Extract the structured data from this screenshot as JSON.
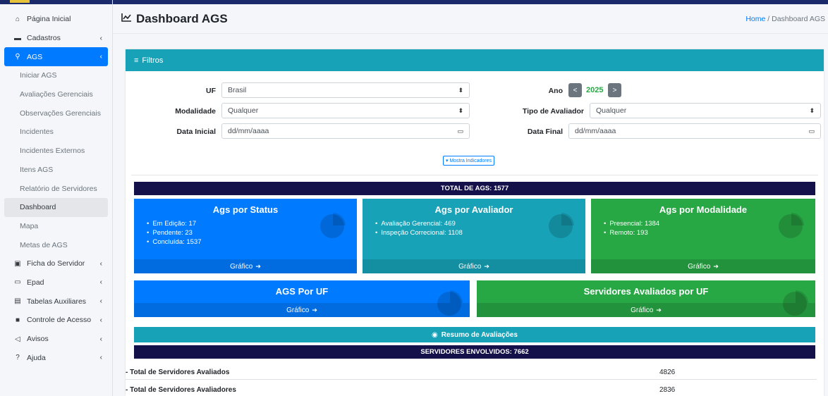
{
  "sidebar": {
    "items": [
      {
        "label": "Página Inicial",
        "icon": "home-icon",
        "glyph": "⌂"
      },
      {
        "label": "Cadastros",
        "icon": "folder-icon",
        "glyph": "▬",
        "chevron": "‹"
      },
      {
        "label": "AGS",
        "icon": "search-icon",
        "glyph": "⚲",
        "chevron": "‹"
      },
      {
        "label": "Iniciar AGS"
      },
      {
        "label": "Avaliações Gerenciais"
      },
      {
        "label": "Observações Gerenciais"
      },
      {
        "label": "Incidentes"
      },
      {
        "label": "Incidentes Externos"
      },
      {
        "label": "Itens AGS"
      },
      {
        "label": "Relatório de Servidores"
      },
      {
        "label": "Dashboard"
      },
      {
        "label": "Mapa"
      },
      {
        "label": "Metas de AGS"
      },
      {
        "label": "Ficha do Servidor",
        "icon": "id-card-icon",
        "glyph": "▣",
        "chevron": "‹"
      },
      {
        "label": "Epad",
        "icon": "tablet-icon",
        "glyph": "▭",
        "chevron": "‹"
      },
      {
        "label": "Tabelas Auxiliares",
        "icon": "table-icon",
        "glyph": "▤",
        "chevron": "‹"
      },
      {
        "label": "Controle de Acesso",
        "icon": "lock-icon",
        "glyph": "■",
        "chevron": "‹"
      },
      {
        "label": "Avisos",
        "icon": "megaphone-icon",
        "glyph": "◁",
        "chevron": "‹"
      },
      {
        "label": "Ajuda",
        "icon": "question-icon",
        "glyph": "?",
        "chevron": "‹"
      }
    ]
  },
  "header": {
    "title": "Dashboard AGS",
    "breadcrumb_home": "Home",
    "breadcrumb_sep": " / ",
    "breadcrumb_current": "Dashboard AGS"
  },
  "filters": {
    "title": "Filtros",
    "uf_label": "UF",
    "uf_value": "Brasil",
    "ano_label": "Ano",
    "ano_prev": "<",
    "ano_value": "2025",
    "ano_next": ">",
    "modalidade_label": "Modalidade",
    "modalidade_value": "Qualquer",
    "tipo_label": "Tipo de Avaliador",
    "tipo_value": "Qualquer",
    "data_inicial_label": "Data Inicial",
    "data_inicial_placeholder": "dd/mm/aaaa",
    "data_final_label": "Data Final",
    "data_final_placeholder": "dd/mm/aaaa",
    "mostra_indicadores": "▾ Mostra Indicadores"
  },
  "total_ags": "TOTAL DE AGS: 1577",
  "cards": {
    "status": {
      "title": "Ags por Status",
      "items": [
        "Em Edição: 17",
        "Pendente: 23",
        "Concluída: 1537"
      ],
      "footer": "Gráfico"
    },
    "avaliador": {
      "title": "Ags por Avaliador",
      "items": [
        "Avaliação Gerencial: 469",
        "Inspeção Correcional: 1108"
      ],
      "footer": "Gráfico"
    },
    "modalidade": {
      "title": "Ags por Modalidade",
      "items": [
        "Presencial: 1384",
        "Remoto: 193"
      ],
      "footer": "Gráfico"
    },
    "uf": {
      "title": "AGS Por UF",
      "footer": "Gráfico"
    },
    "servidores_uf": {
      "title": "Servidores Avaliados por UF",
      "footer": "Gráfico"
    }
  },
  "resumo_label": "Resumo de Avaliações",
  "servidores_envolvidos": "SERVIDORES ENVOLVIDOS: 7662",
  "summary": [
    {
      "label": "- Total de Servidores Avaliados",
      "value": "4826"
    },
    {
      "label": "- Total de Servidores Avaliadores",
      "value": "2836"
    }
  ],
  "colors": {
    "primary": "#007bff",
    "info": "#17a2b8",
    "success": "#28a745",
    "dark_navy": "#14104a"
  }
}
